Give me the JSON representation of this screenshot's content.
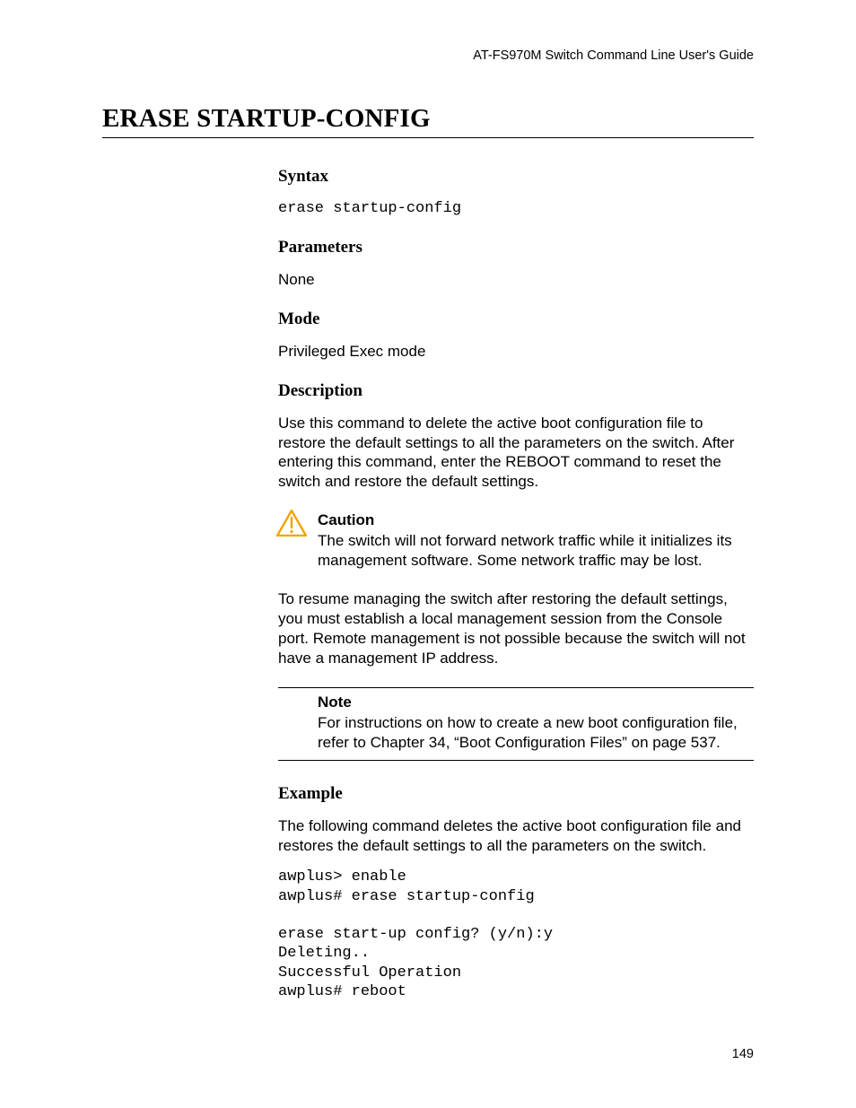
{
  "header": {
    "running_head": "AT-FS970M Switch Command Line User's Guide"
  },
  "title": "ERASE STARTUP-CONFIG",
  "sections": {
    "syntax": {
      "heading": "Syntax",
      "code": "erase startup-config"
    },
    "parameters": {
      "heading": "Parameters",
      "text": "None"
    },
    "mode": {
      "heading": "Mode",
      "text": "Privileged Exec mode"
    },
    "description": {
      "heading": "Description",
      "para1": "Use this command to delete the active boot configuration file to restore the default settings to all the parameters on the switch. After entering this command, enter the REBOOT command to reset the switch and restore the default settings.",
      "caution_label": "Caution",
      "caution_text": "The switch will not forward network traffic while it initializes its management software. Some network traffic may be lost.",
      "para2": "To resume managing the switch after restoring the default settings, you must establish a local management session from the Console port. Remote management is not possible because the switch will not have a management IP address.",
      "note_label": "Note",
      "note_text": "For instructions on how to create a new boot configuration file, refer to Chapter 34, “Boot Configuration Files” on page 537."
    },
    "example": {
      "heading": "Example",
      "intro": "The following command deletes the active boot configuration file and restores the default settings to all the parameters on the switch.",
      "code": "awplus> enable\nawplus# erase startup-config\n\nerase start-up config? (y/n):y\nDeleting..\nSuccessful Operation\nawplus# reboot"
    }
  },
  "footer": {
    "page_number": "149"
  }
}
